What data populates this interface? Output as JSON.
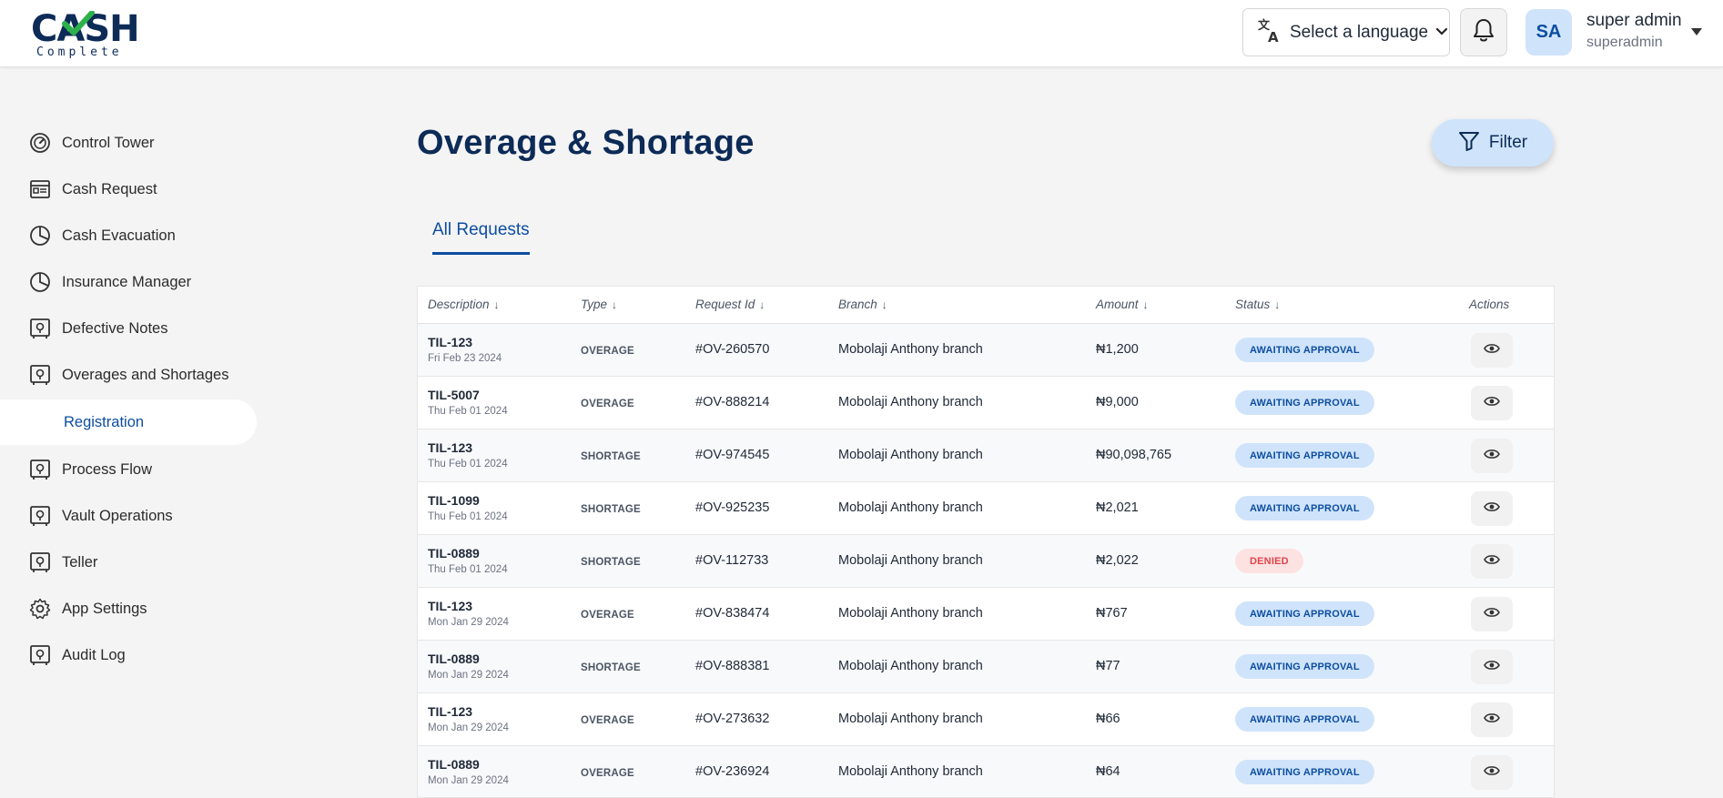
{
  "brand": {
    "logo_text": "CASH",
    "logo_sub": "Complete"
  },
  "header": {
    "language_label": "Select a language",
    "avatar_initials": "SA",
    "user_name": "super admin",
    "user_handle": "superadmin"
  },
  "sidebar": {
    "items": [
      {
        "label": "Control Tower",
        "icon": "speedometer-icon"
      },
      {
        "label": "Cash Request",
        "icon": "cash-request-icon"
      },
      {
        "label": "Cash Evacuation",
        "icon": "pie-chart-icon"
      },
      {
        "label": "Insurance Manager",
        "icon": "pie-chart-icon"
      },
      {
        "label": "Defective Notes",
        "icon": "safe-icon"
      },
      {
        "label": "Overages and Shortages",
        "icon": "safe-icon"
      },
      {
        "label": "Registration",
        "icon": "",
        "sub": true,
        "active": true
      },
      {
        "label": "Process Flow",
        "icon": "safe-icon"
      },
      {
        "label": "Vault Operations",
        "icon": "safe-icon"
      },
      {
        "label": "Teller",
        "icon": "safe-icon"
      },
      {
        "label": "App Settings",
        "icon": "gear-icon"
      },
      {
        "label": "Audit Log",
        "icon": "safe-icon"
      }
    ]
  },
  "main": {
    "title": "Overage & Shortage",
    "filter_label": "Filter",
    "tab_label": "All Requests"
  },
  "table": {
    "columns": [
      "Description",
      "Type",
      "Request Id",
      "Branch",
      "Amount",
      "Status",
      "Actions"
    ],
    "rows": [
      {
        "desc": "TIL-123",
        "date": "Fri Feb 23 2024",
        "type": "OVERAGE",
        "request_id": "#OV-260570",
        "branch": "Mobolaji Anthony branch",
        "amount": "₦1,200",
        "status": "AWAITING APPROVAL"
      },
      {
        "desc": "TIL-5007",
        "date": "Thu Feb 01 2024",
        "type": "OVERAGE",
        "request_id": "#OV-888214",
        "branch": "Mobolaji Anthony branch",
        "amount": "₦9,000",
        "status": "AWAITING APPROVAL"
      },
      {
        "desc": "TIL-123",
        "date": "Thu Feb 01 2024",
        "type": "SHORTAGE",
        "request_id": "#OV-974545",
        "branch": "Mobolaji Anthony branch",
        "amount": "₦90,098,765",
        "status": "AWAITING APPROVAL"
      },
      {
        "desc": "TIL-1099",
        "date": "Thu Feb 01 2024",
        "type": "SHORTAGE",
        "request_id": "#OV-925235",
        "branch": "Mobolaji Anthony branch",
        "amount": "₦2,021",
        "status": "AWAITING APPROVAL"
      },
      {
        "desc": "TIL-0889",
        "date": "Thu Feb 01 2024",
        "type": "SHORTAGE",
        "request_id": "#OV-112733",
        "branch": "Mobolaji Anthony branch",
        "amount": "₦2,022",
        "status": "DENIED"
      },
      {
        "desc": "TIL-123",
        "date": "Mon Jan 29 2024",
        "type": "OVERAGE",
        "request_id": "#OV-838474",
        "branch": "Mobolaji Anthony branch",
        "amount": "₦767",
        "status": "AWAITING APPROVAL"
      },
      {
        "desc": "TIL-0889",
        "date": "Mon Jan 29 2024",
        "type": "SHORTAGE",
        "request_id": "#OV-888381",
        "branch": "Mobolaji Anthony branch",
        "amount": "₦77",
        "status": "AWAITING APPROVAL"
      },
      {
        "desc": "TIL-123",
        "date": "Mon Jan 29 2024",
        "type": "OVERAGE",
        "request_id": "#OV-273632",
        "branch": "Mobolaji Anthony branch",
        "amount": "₦66",
        "status": "AWAITING APPROVAL"
      },
      {
        "desc": "TIL-0889",
        "date": "Mon Jan 29 2024",
        "type": "OVERAGE",
        "request_id": "#OV-236924",
        "branch": "Mobolaji Anthony branch",
        "amount": "₦64",
        "status": "AWAITING APPROVAL"
      }
    ]
  },
  "colors": {
    "brand_navy": "#0d2b57",
    "accent_blue": "#0d4da1",
    "badge_blue": "#cfe4fb",
    "denied_red": "#e0444b",
    "check_green": "#2db24a"
  }
}
